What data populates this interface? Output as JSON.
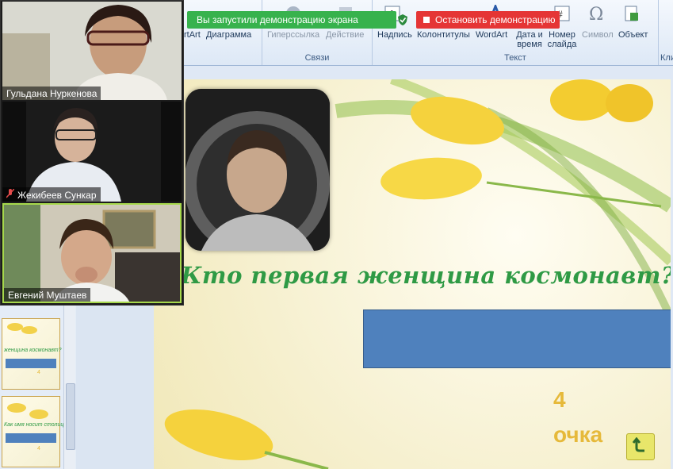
{
  "ribbon": {
    "groups": [
      {
        "label": "Связи",
        "buttons": [
          "Гиперссылка",
          "Действие"
        ]
      },
      {
        "label": "Текст",
        "buttons": [
          "Надпись",
          "Колонтитулы",
          "WordArt",
          "Дата и время",
          "Номер слайда",
          "Символ",
          "Объект"
        ]
      },
      {
        "label": "Кли"
      }
    ],
    "partial_buttons": [
      "rtArt",
      "Диаграмма"
    ]
  },
  "screen_share": {
    "status_text": "Вы запустили демонстрацию экрана",
    "stop_label": "Остановить демонстрацию",
    "accent": "#37b24d",
    "stop_color": "#e53535"
  },
  "participants": [
    {
      "name": "Гульдана Нуркенова",
      "muted": false
    },
    {
      "name": "Жекибеев Сункар",
      "muted": true
    },
    {
      "name": "Евгений Муштаев",
      "muted": false
    }
  ],
  "slide": {
    "question": "Кто первая женщина космонавт?",
    "points_value": "4",
    "points_label": "очка",
    "answer_box_color": "#4f81bd",
    "text_color": "#2f9a45",
    "points_color": "#e6b93a"
  },
  "thumbnails": [
    {
      "title": "женщина космонавт?",
      "points": "4"
    },
    {
      "title": "Как имя носит столица",
      "points": "4"
    }
  ]
}
